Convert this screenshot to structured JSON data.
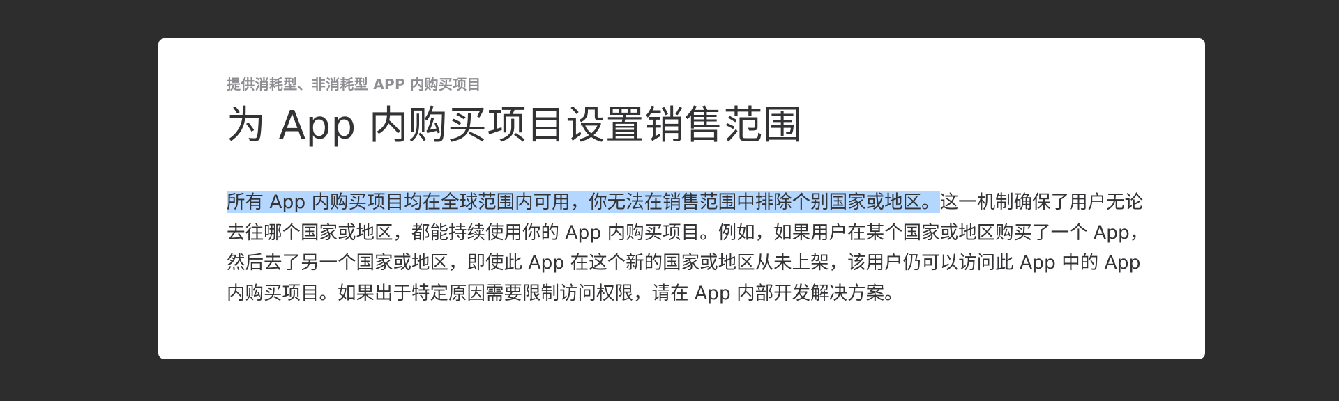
{
  "article": {
    "eyebrow": "提供消耗型、非消耗型 APP 内购买项目",
    "title": "为 App 内购买项目设置销售范围",
    "body_selected": "所有 App 内购买项目均在全球范围内可用，你无法在销售范围中排除个别国家或地区。",
    "body_rest": "这一机制确保了用户无论去往哪个国家或地区，都能持续使用你的 App 内购买项目。例如，如果用户在某个国家或地区购买了一个 App，然后去了另一个国家或地区，即使此 App 在这个新的国家或地区从未上架，该用户仍可以访问此 App 中的 App 内购买项目。如果出于特定原因需要限制访问权限，请在 App 内部开发解决方案。"
  },
  "colors": {
    "page_background": "#2d2d2d",
    "card_background": "#ffffff",
    "selection_highlight": "#b3d7ff",
    "eyebrow_text": "#8e8e93",
    "body_text": "#333336"
  }
}
